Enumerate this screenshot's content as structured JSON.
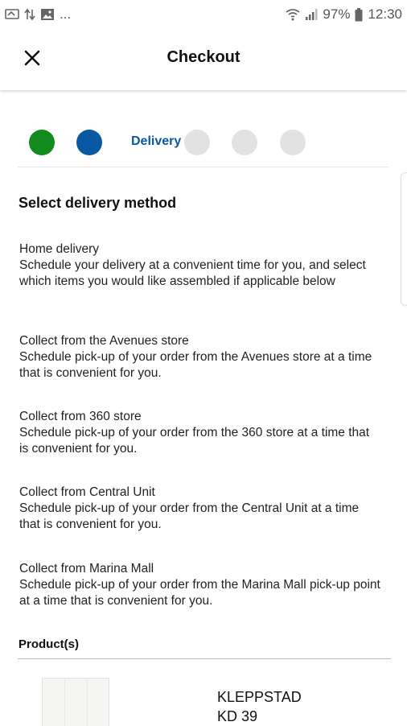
{
  "status_bar": {
    "left_extra": "...",
    "battery": "97%",
    "time": "12:30",
    "left_icons": [
      "screen-cast-icon",
      "data-transfer-icon",
      "image-icon"
    ],
    "right_icons": [
      "wifi-icon",
      "signal-icon",
      "battery-icon"
    ]
  },
  "header": {
    "title": "Checkout",
    "close_icon": "close-icon"
  },
  "steps": {
    "active_label": "Delivery",
    "colors": {
      "completed": "#118a1e",
      "active": "#0a57a4",
      "pending": "#e2e2e2",
      "active_label": "#0a57a4"
    }
  },
  "delivery": {
    "title": "Select delivery method",
    "options": [
      {
        "title": "Home delivery",
        "description": "Schedule your delivery at a convenient time for you, and select which items you would like assembled if applicable below"
      },
      {
        "title": "Collect from the Avenues store",
        "description": "Schedule pick-up of your order from the Avenues store at a time that is convenient for you."
      },
      {
        "title": "Collect from 360 store",
        "description": "Schedule pick-up of your order from the 360 store at a time that is convenient for you."
      },
      {
        "title": "Collect from Central Unit",
        "description": "Schedule pick-up of your order from the Central Unit at a time that is convenient for you."
      },
      {
        "title": "Collect from Marina Mall",
        "description": "Schedule pick-up of your order from the Marina Mall pick-up point at a time that is convenient for you."
      }
    ]
  },
  "products": {
    "title": "Product(s)",
    "items": [
      {
        "name": "KLEPPSTAD",
        "price": "KD 39"
      }
    ]
  }
}
